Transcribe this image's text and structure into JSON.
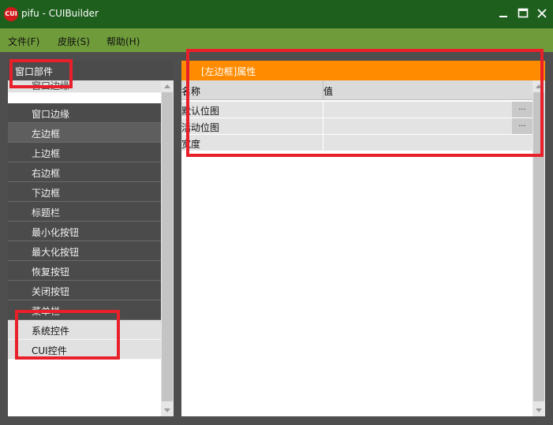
{
  "window": {
    "title": "pifu - CUIBuilder",
    "icon_text": "CUI",
    "controls": [
      "minimize",
      "maximize",
      "close"
    ]
  },
  "menu": [
    {
      "label": "文件(F)"
    },
    {
      "label": "皮肤(S)"
    },
    {
      "label": "帮助(H)"
    }
  ],
  "left_panel": {
    "header": "窗口部件",
    "items": [
      {
        "label": "窗口边缘",
        "style": "light"
      },
      {
        "label": "窗口边缘",
        "style": "dark"
      },
      {
        "label": "左边框",
        "style": "dark",
        "selected": true
      },
      {
        "label": "上边框",
        "style": "dark"
      },
      {
        "label": "右边框",
        "style": "dark"
      },
      {
        "label": "下边框",
        "style": "dark"
      },
      {
        "label": "标题栏",
        "style": "dark"
      },
      {
        "label": "最小化按钮",
        "style": "dark"
      },
      {
        "label": "最大化按钮",
        "style": "dark"
      },
      {
        "label": "恢复按钮",
        "style": "dark"
      },
      {
        "label": "关闭按钮",
        "style": "dark"
      },
      {
        "label": "菜单栏",
        "style": "dark"
      },
      {
        "label": "系统控件",
        "style": "light"
      },
      {
        "label": "CUI控件",
        "style": "light"
      }
    ]
  },
  "right_panel": {
    "header": "[左边框]属性",
    "columns": [
      "名称",
      "值"
    ],
    "rows": [
      {
        "name": "默认位图",
        "value": "",
        "button": "..."
      },
      {
        "name": "活动位图",
        "value": "",
        "button": "..."
      },
      {
        "name": "宽度",
        "value": ""
      }
    ]
  },
  "colors": {
    "titlebar": "#1e5f1e",
    "menubar": "#6f9b3a",
    "accent": "#ff8c00",
    "annotation": "#e8202a"
  }
}
